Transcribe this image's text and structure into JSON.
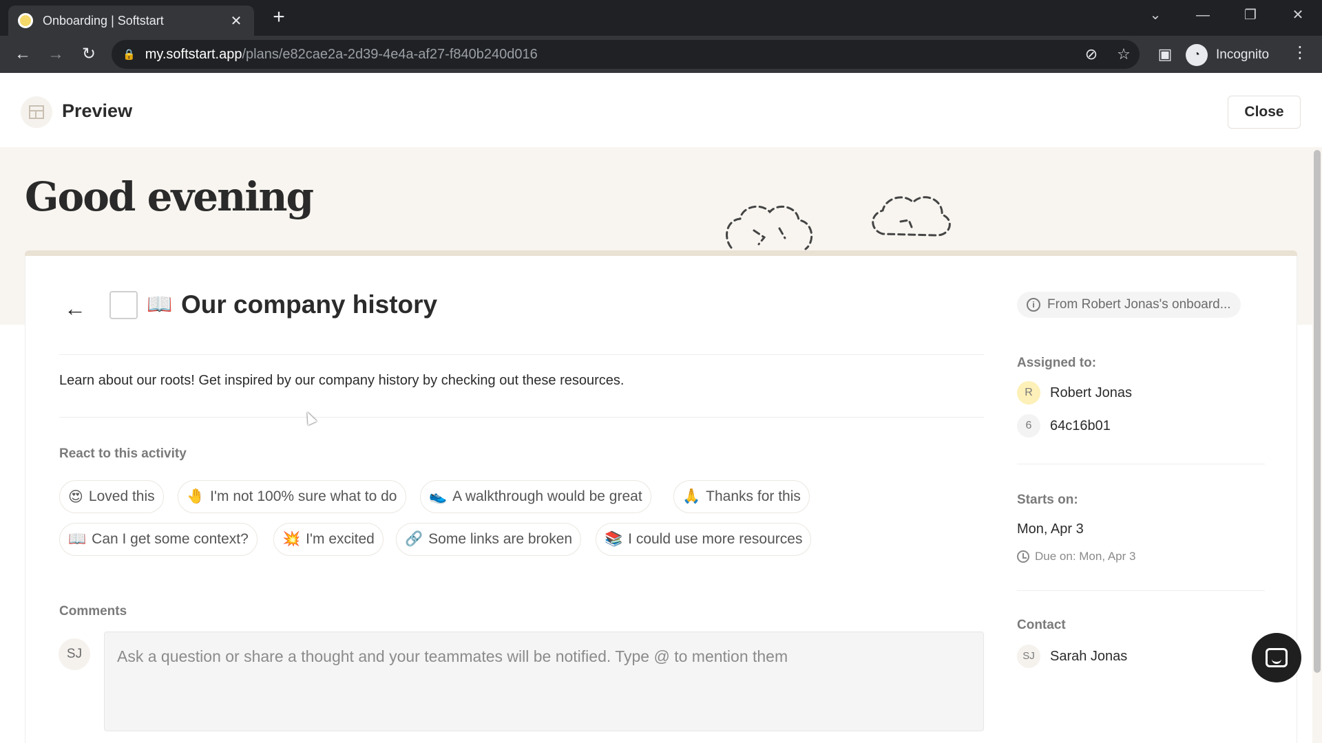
{
  "browser": {
    "tab_title": "Onboarding | Softstart",
    "url_host": "my.softstart.app",
    "url_path": "/plans/e82cae2a-2d39-4e4a-af27-f840b240d016",
    "profile_label": "Incognito"
  },
  "header": {
    "title": "Preview",
    "close_label": "Close"
  },
  "hero": {
    "greeting": "Good evening"
  },
  "task": {
    "icon": "open-book-icon",
    "title": "Our company history",
    "description": "Learn about our roots! Get inspired by our company history by checking out these resources.",
    "react_label": "React to this activity",
    "reactions": [
      {
        "emoji": "😍",
        "label": "Loved this"
      },
      {
        "emoji": "🤚",
        "label": "I'm not 100% sure what to do"
      },
      {
        "emoji": "👟",
        "label": "A walkthrough would be great"
      },
      {
        "emoji": "🙏",
        "label": "Thanks for this"
      },
      {
        "emoji": "📖",
        "label": "Can I get some context?"
      },
      {
        "emoji": "💥",
        "label": "I'm excited"
      },
      {
        "emoji": "🔗",
        "label": "Some links are broken"
      },
      {
        "emoji": "📚",
        "label": "I could use more resources"
      }
    ],
    "comments_label": "Comments",
    "commenter_initials": "SJ",
    "comment_placeholder": "Ask a question or share a thought and your teammates will be notified. Type @ to mention them"
  },
  "sidebar": {
    "origin": "From Robert Jonas's onboard...",
    "assigned_label": "Assigned to:",
    "assignees": [
      {
        "initial": "R",
        "name": "Robert Jonas",
        "color": "#fdf0b8"
      },
      {
        "initial": "6",
        "name": "64c16b01",
        "color": "#f3f3f3"
      }
    ],
    "starts_label": "Starts on:",
    "starts_value": "Mon, Apr 3",
    "due_text": "Due on: Mon, Apr 3",
    "contact_label": "Contact",
    "contact": {
      "initials": "SJ",
      "name": "Sarah Jonas"
    }
  },
  "colors": {
    "hero_bg": "#f8f5f0",
    "accent_bar": "#e9e1d3"
  }
}
